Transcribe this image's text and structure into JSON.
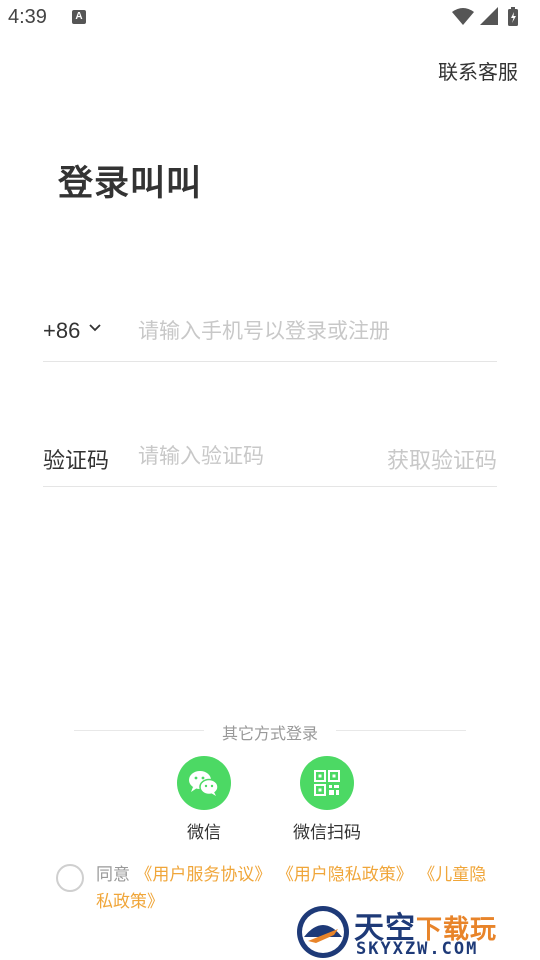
{
  "status_bar": {
    "time": "4:39",
    "notif_icon": "A"
  },
  "header": {
    "contact_label": "联系客服"
  },
  "title": "登录叫叫",
  "phone": {
    "country_code": "+86",
    "placeholder": "请输入手机号以登录或注册"
  },
  "code": {
    "label": "验证码",
    "placeholder": "请输入验证码",
    "get_code_label": "获取验证码"
  },
  "other_login": {
    "label": "其它方式登录",
    "options": [
      {
        "label": "微信",
        "icon": "wechat-icon",
        "color": "#4cd964"
      },
      {
        "label": "微信扫码",
        "icon": "qrcode-icon",
        "color": "#4cd964"
      }
    ]
  },
  "agreement": {
    "prefix": "同意",
    "links": [
      "《用户服务协议》",
      "《用户隐私政策》",
      "《儿童隐私政策》"
    ]
  },
  "watermark": {
    "title_a": "天空",
    "title_b": "下载玩",
    "subtitle": "SKYXZW.COM"
  },
  "colors": {
    "accent_green": "#4cd964",
    "link_orange": "#f0a63a",
    "placeholder_gray": "#c8c8c8"
  }
}
